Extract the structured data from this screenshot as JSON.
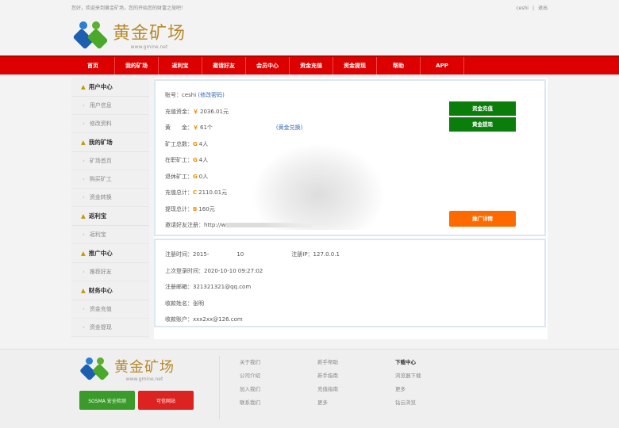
{
  "topbar": {
    "welcome": "您好，欢迎来到黄金矿场，您的开始您的财富之旅吧！",
    "user": "ceshi",
    "sep": "|",
    "logout": "退出"
  },
  "logo": {
    "name": "黄金矿场",
    "url": "www.gmine.net"
  },
  "nav": [
    "首页",
    "我的矿场",
    "返利宝",
    "邀请好友",
    "会员中心",
    "资金充值",
    "资金提现",
    "帮助",
    "APP"
  ],
  "sidebar": [
    {
      "title": "用户中心",
      "items": [
        "用户信息",
        "修改资料"
      ]
    },
    {
      "title": "我的矿场",
      "items": [
        "矿场首页",
        "购买矿工",
        "资金转换"
      ]
    },
    {
      "title": "返利宝",
      "items": [
        "返利宝"
      ]
    },
    {
      "title": "推广中心",
      "items": [
        "推荐好友"
      ]
    },
    {
      "title": "财务中心",
      "items": [
        "资金充值",
        "资金提现"
      ]
    }
  ],
  "account": {
    "rows": [
      {
        "label": "账号：",
        "sym": "",
        "value": "ceshi",
        "link": "(修改密码)"
      },
      {
        "label": "充值资金：",
        "sym": "￥",
        "value": "2036.01元",
        "link": ""
      },
      {
        "label": "黄　　金：",
        "sym": "￥",
        "value": "61个",
        "link": "(黄金兑换)"
      },
      {
        "label": "矿工总数：",
        "sym": "G",
        "value": "4人",
        "link": ""
      },
      {
        "label": "在职矿工：",
        "sym": "G",
        "value": "4人",
        "link": ""
      },
      {
        "label": "退休矿工：",
        "sym": "G",
        "value": "0人",
        "link": ""
      },
      {
        "label": "充值总计：",
        "sym": "C",
        "value": "2110.01元",
        "link": ""
      },
      {
        "label": "提现总计：",
        "sym": "B",
        "value": "160元",
        "link": ""
      },
      {
        "label": "邀请好友注册：",
        "sym": "",
        "value": "http://w",
        "link": ""
      }
    ],
    "buttons": {
      "recharge": "资金充值",
      "withdraw": "黄金提现",
      "promo": "推广详情"
    }
  },
  "info": {
    "reg_time_label": "注册时间：",
    "reg_time": "2015-　　　　　10",
    "reg_ip_label": "注册IP：",
    "reg_ip": "127.0.0.1",
    "last_login_label": "上次登录时间：",
    "last_login": "2020-10-10 09:27:02",
    "email_label": "注册邮箱：",
    "email": "321321321@qq.com",
    "payee_label": "收款姓名：",
    "payee": "张明",
    "account_label": "收款账户：",
    "account": "xxx2xx@126.com"
  },
  "footer": {
    "col1": [
      "关于我们",
      "公司介绍",
      "加入我们",
      "联系我们"
    ],
    "col2": [
      "新手帮助",
      "新手指南",
      "充值指南",
      "更多"
    ],
    "col3": [
      "下载中心",
      "浏览器下载",
      "更多",
      "钻云浏览"
    ],
    "badge1": "SOSMA 安全检测",
    "badge2": "可信网站"
  },
  "colors": {
    "nav": "#dd0000",
    "green": "#0b7d0b",
    "orange": "#ff6a00",
    "gold": "#b78a2c"
  }
}
